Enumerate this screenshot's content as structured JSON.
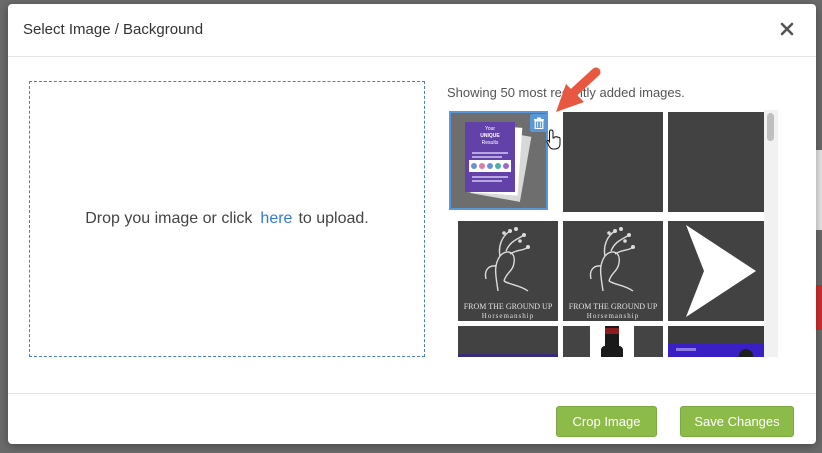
{
  "modal": {
    "title": "Select Image / Background"
  },
  "dropzone": {
    "text_before": "Drop you image or click",
    "link": "here",
    "text_after": "to upload."
  },
  "gallery": {
    "note": "Showing 50 most recently added images.",
    "thumb1": {
      "title_line1": "Your",
      "title_line2": "UNIQUE",
      "title_line3": "Results"
    },
    "logo_line1": "FROM THE GROUND UP",
    "logo_line2": "Horsemanship"
  },
  "footer": {
    "crop_label": "Crop Image",
    "save_label": "Save Changes"
  },
  "colors": {
    "accent_green": "#8cbb4a",
    "selection_blue": "#5b96d6",
    "annotation_red": "#e8573f"
  }
}
